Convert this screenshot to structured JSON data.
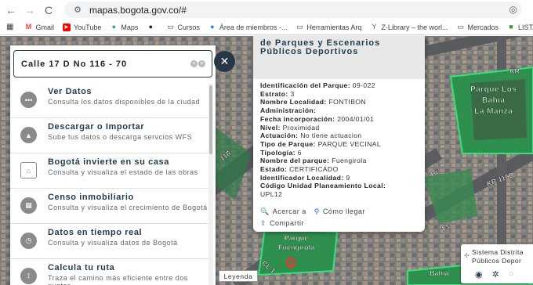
{
  "browser": {
    "url": "mapas.bogota.gov.co/#",
    "bookmarks": [
      "Gmail",
      "YouTube",
      "Maps",
      "Cursos",
      "Área de miembros -...",
      "Herramientas Arq",
      "Z-Library – the worl...",
      "Mercados",
      "LISTADO DE PERIO"
    ]
  },
  "search": {
    "value": "Calle 17 D No 116 - 70"
  },
  "menu": [
    {
      "title": "Ver Datos",
      "desc": "Consulta los datos disponibles de la ciudad",
      "icon": "dots-icon"
    },
    {
      "title": "Descargar o Importar",
      "desc": "Sube tus datos o descarga servcios WFS",
      "icon": "upload-icon"
    },
    {
      "title": "Bogotá invierte en su casa",
      "desc": "Consulta y visualiza el estado de las obras",
      "icon": "house-icon"
    },
    {
      "title": "Censo inmobiliario",
      "desc": "Consulta y visualiza el crecimiento de Bogotá",
      "icon": "building-icon"
    },
    {
      "title": "Datos en tiempo real",
      "desc": "Consulta y visualiza datos de Bogotá",
      "icon": "clock-icon"
    },
    {
      "title": "Calcula tu ruta",
      "desc": "Traza el camino más eficiente entre dos puntos",
      "icon": "route-icon"
    }
  ],
  "popup": {
    "title": "de Parques y Escenarios Públicos Deportivos",
    "fields": [
      {
        "label": "Identificación del Parque:",
        "value": "09-022"
      },
      {
        "label": "Estrato:",
        "value": "3"
      },
      {
        "label": "Nombre Localidad:",
        "value": "FONTIBON"
      },
      {
        "label": "Administración:",
        "value": ""
      },
      {
        "label": "Fecha incorporación:",
        "value": "2004/01/01"
      },
      {
        "label": "Nivel:",
        "value": "Proximidad"
      },
      {
        "label": "Actuación:",
        "value": "No tiene actuacion"
      },
      {
        "label": "Tipo de Parque:",
        "value": "PARQUE VECINAL"
      },
      {
        "label": "Tipología:",
        "value": "6"
      },
      {
        "label": "Nombre del parque:",
        "value": "Fuengirola"
      },
      {
        "label": "Estado:",
        "value": "CERTIFICADO"
      },
      {
        "label": "Identificador Localidad:",
        "value": "9"
      },
      {
        "label": "Código Unidad Planeamiento Local:",
        "value": ""
      }
    ],
    "upl_value": "UPL12",
    "actions": {
      "zoom": "Acercar a",
      "route": "Cómo llegar",
      "share": "Compartir"
    }
  },
  "map": {
    "labels": {
      "parque_bahia": [
        "Parque Los",
        "Bahía",
        "La Manza"
      ],
      "parque_fuengirola": [
        "Parque",
        "Fuengirola"
      ],
      "bahia_bottom": "Bahía",
      "street_kr": "KR 116B",
      "street_118": "118",
      "street_cl": "CL 1",
      "street_11": "11",
      "street_16": "16",
      "street_13": "13",
      "street_kr_right": "KR"
    },
    "legend_button": "Leyenda",
    "system_panel": "Sistema Distrital Públicos Depor",
    "system_lines": [
      "Sistema Distrita",
      "Públicos Depor"
    ]
  }
}
